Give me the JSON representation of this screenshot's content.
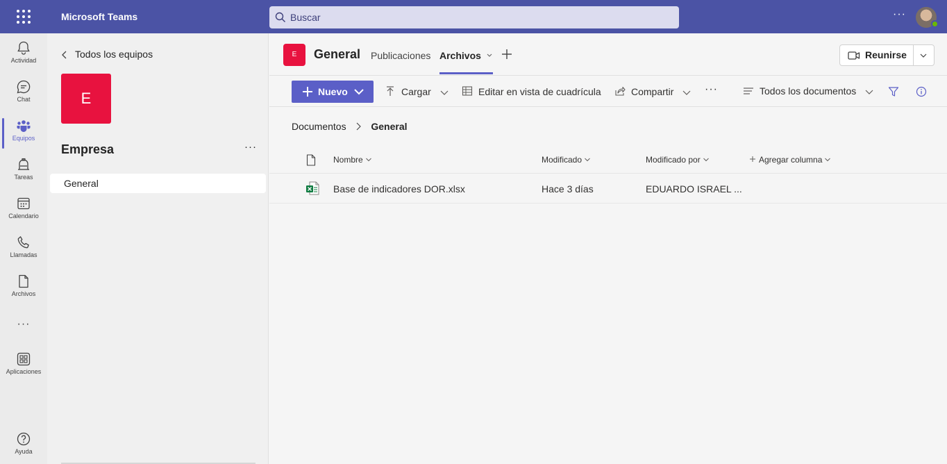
{
  "app": {
    "title": "Microsoft Teams"
  },
  "search": {
    "placeholder": "Buscar"
  },
  "rail": [
    {
      "label": "Actividad",
      "icon": "bell-icon"
    },
    {
      "label": "Chat",
      "icon": "chat-icon"
    },
    {
      "label": "Equipos",
      "icon": "teams-icon",
      "active": true
    },
    {
      "label": "Tareas",
      "icon": "tasks-icon"
    },
    {
      "label": "Calendario",
      "icon": "calendar-icon"
    },
    {
      "label": "Llamadas",
      "icon": "phone-icon"
    },
    {
      "label": "Archivos",
      "icon": "file-icon"
    },
    {
      "label": "Aplicaciones",
      "icon": "apps-icon"
    },
    {
      "label": "Ayuda",
      "icon": "help-icon"
    }
  ],
  "panel": {
    "back_label": "Todos los equipos",
    "team_initial": "E",
    "team_name": "Empresa",
    "channel": "General"
  },
  "channel": {
    "initial": "E",
    "title": "General",
    "tabs": [
      {
        "label": "Publicaciones"
      },
      {
        "label": "Archivos",
        "active": true
      }
    ],
    "meet_label": "Reunirse"
  },
  "toolbar": {
    "new_label": "Nuevo",
    "upload_label": "Cargar",
    "grid_label": "Editar en vista de cuadrícula",
    "share_label": "Compartir",
    "view_label": "Todos los documentos"
  },
  "breadcrumb": {
    "root": "Documentos",
    "current": "General"
  },
  "table": {
    "headers": {
      "name": "Nombre",
      "modified": "Modificado",
      "modified_by": "Modificado por",
      "add_column": "Agregar columna"
    },
    "rows": [
      {
        "name": "Base de indicadores DOR.xlsx",
        "modified": "Hace 3 días",
        "modified_by": "EDUARDO ISRAEL ...",
        "type": "excel"
      }
    ]
  },
  "colors": {
    "accent": "#5b5fc7",
    "topbar": "#4b53a5",
    "team": "#e8123f",
    "excel": "#107c41"
  }
}
